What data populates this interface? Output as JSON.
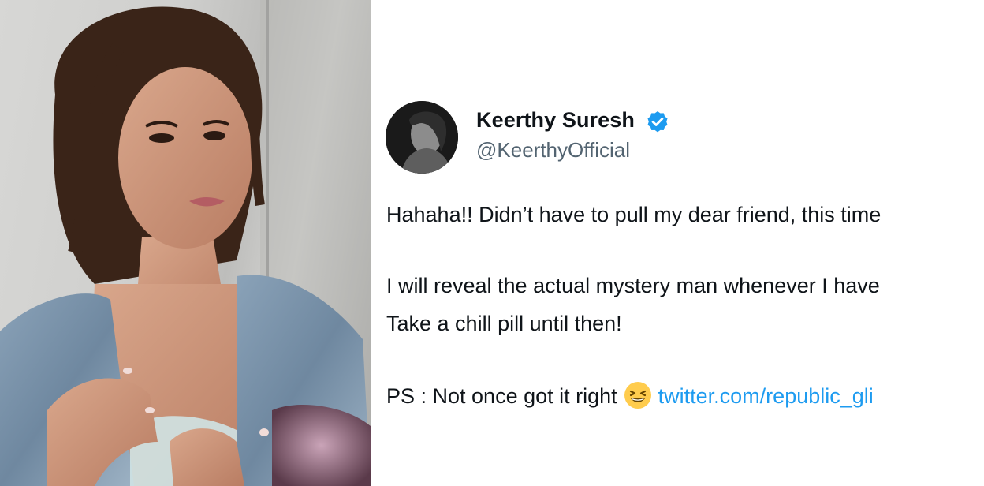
{
  "photo": {
    "alt_subject": "woman-in-denim-jacket"
  },
  "tweet": {
    "author": {
      "display_name": "Keerthy Suresh",
      "handle": "@KeerthyOfficial",
      "verified": true,
      "verified_color": "#1d9bf0"
    },
    "lines": [
      "Hahaha!! Didn’t have to pull my dear friend, this time",
      "I will reveal the actual mystery man whenever I have",
      "Take a chill pill until then!"
    ],
    "ps_text": "PS : Not once got it right",
    "emoji": "grinning-squinting-face-icon",
    "link_text": "twitter.com/republic_gli",
    "colors": {
      "text": "#0f1419",
      "secondary": "#536471",
      "link": "#1d9bf0"
    }
  }
}
